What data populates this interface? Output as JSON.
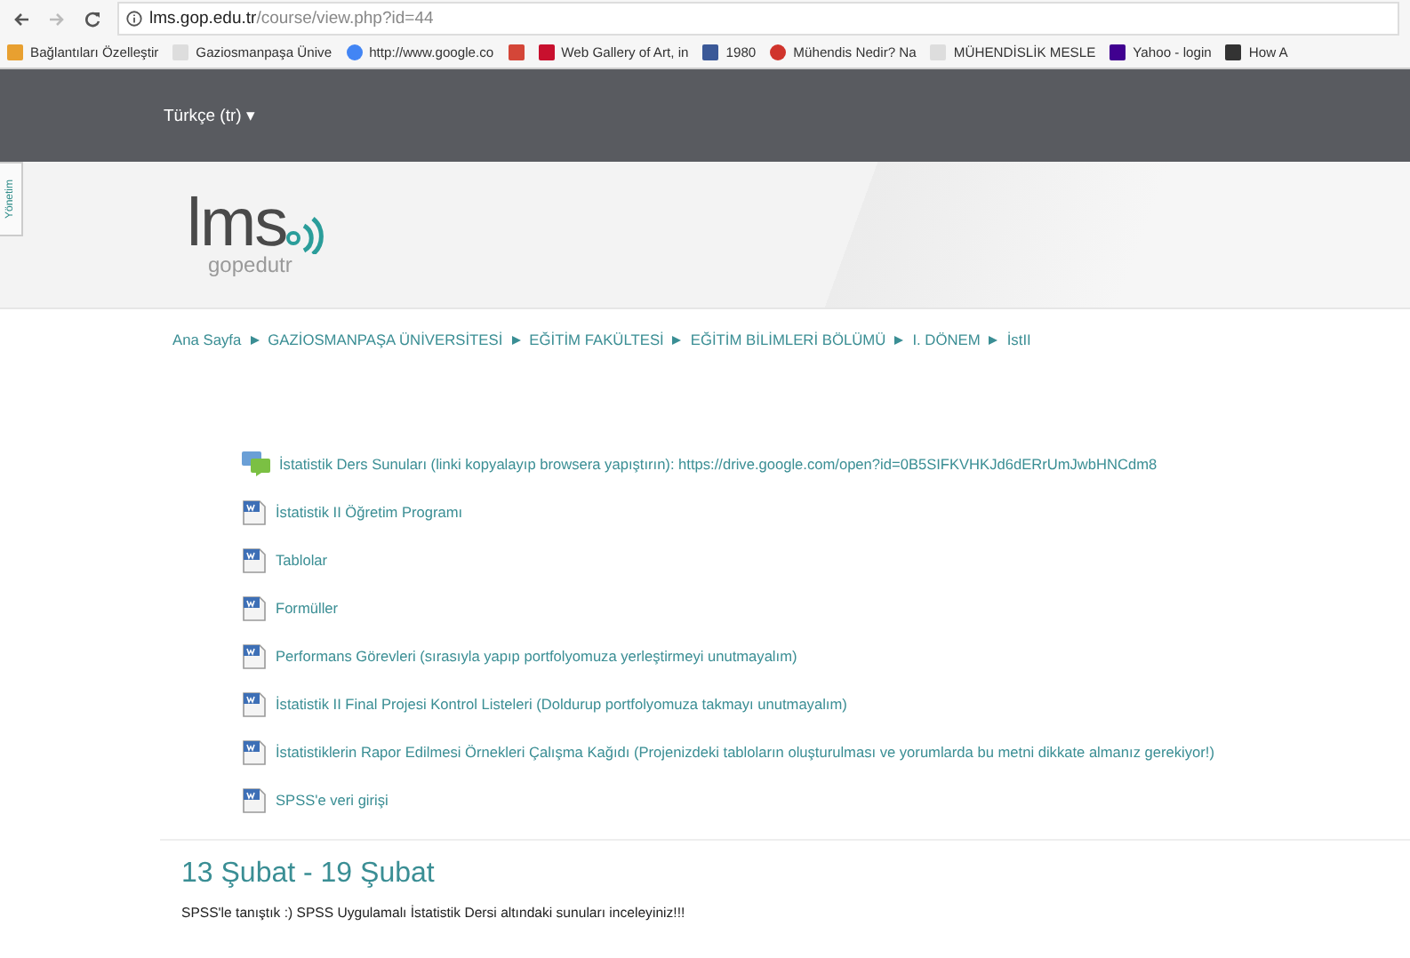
{
  "browser": {
    "url_host": "lms.gop.edu.tr",
    "url_path": "/course/view.php?id=44",
    "bookmarks": [
      {
        "kind": "apps",
        "label": "Bağlantıları Özelleştir"
      },
      {
        "kind": "page",
        "label": "Gaziosmanpaşa Ünive"
      },
      {
        "kind": "google",
        "label": "http://www.google.co"
      },
      {
        "kind": "gmail"
      },
      {
        "kind": "adobe",
        "label": "Web Gallery of Art, in"
      },
      {
        "kind": "facebook",
        "label": "1980"
      },
      {
        "kind": "round",
        "label": "Mühendis Nedir? Na"
      },
      {
        "kind": "page",
        "label": "MÜHENDİSLİK MESLE"
      },
      {
        "kind": "yahoo",
        "label": "Yahoo - login"
      },
      {
        "kind": "e",
        "label": "How A"
      }
    ]
  },
  "language_menu": "Türkçe (tr) ▾",
  "side_tab": "Yönetim",
  "logo": {
    "main": "lms",
    "sub": "gopedutr"
  },
  "breadcrumb": [
    "Ana Sayfa",
    "GAZİOSMANPAŞA ÜNİVERSİTESİ",
    "EĞİTİM FAKÜLTESİ",
    "EĞİTİM BİLİMLERİ BÖLÜMÜ",
    "I. DÖNEM",
    "İstII"
  ],
  "resources": [
    {
      "kind": "forum",
      "label": "İstatistik Ders Sunuları (linki kopyalayıp browsera yapıştırın): https://drive.google.com/open?id=0B5SIFKVHKJd6dERrUmJwbHNCdm8"
    },
    {
      "kind": "doc",
      "label": "İstatistik II Öğretim Programı"
    },
    {
      "kind": "doc",
      "label": "Tablolar"
    },
    {
      "kind": "doc",
      "label": "Formüller"
    },
    {
      "kind": "doc",
      "label": "Performans Görevleri (sırasıyla yapıp portfolyomuza yerleştirmeyi unutmayalım)"
    },
    {
      "kind": "doc",
      "label": "İstatistik II Final Projesi Kontrol Listeleri (Doldurup portfolyomuza takmayı unutmayalım)"
    },
    {
      "kind": "doc",
      "label": "İstatistiklerin Rapor Edilmesi Örnekleri Çalışma Kağıdı (Projenizdeki tabloların oluşturulması ve yorumlarda bu metni dikkate almanız gerekiyor!)"
    },
    {
      "kind": "doc",
      "label": "SPSS'e veri girişi"
    }
  ],
  "section": {
    "title": "13 Şubat - 19 Şubat",
    "summary": "SPSS'le tanıştık :) SPSS Uygulamalı İstatistik Dersi  altındaki sunuları inceleyiniz!!!"
  }
}
